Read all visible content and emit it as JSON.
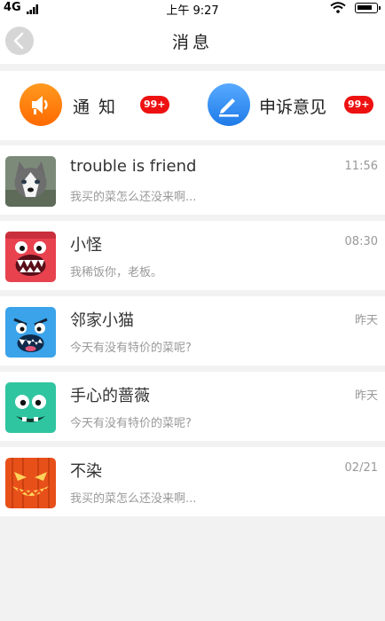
{
  "status_bar": {
    "carrier": "4G",
    "time": "上午 9:27",
    "signal_icon": "signal-icon",
    "wifi_icon": "wifi-icon",
    "battery_icon": "battery-icon"
  },
  "header": {
    "title": "消息",
    "back_icon": "chevron-left-icon"
  },
  "quick_actions": [
    {
      "label": "通知",
      "badge": "99+",
      "icon": "speaker-icon",
      "color": "#ff7a0a"
    },
    {
      "label": "申诉意见",
      "badge": "99+",
      "icon": "edit-icon",
      "color": "#2f8ef0"
    }
  ],
  "colors": {
    "badge": "#ee1111",
    "background": "#f2f2f2"
  },
  "messages": [
    {
      "name": "trouble is friend",
      "time": "11:56",
      "preview": "我买的菜怎么还没来啊...",
      "avatar": "husky-dog-avatar"
    },
    {
      "name": "小怪",
      "time": "08:30",
      "preview": "我稀饭你，老板。",
      "avatar": "red-monster-avatar"
    },
    {
      "name": "邻家小猫",
      "time": "昨天",
      "preview": "今天有没有特价的菜呢?",
      "avatar": "blue-monster-avatar"
    },
    {
      "name": "手心的蔷薇",
      "time": "昨天",
      "preview": "今天有没有特价的菜呢?",
      "avatar": "green-monster-avatar"
    },
    {
      "name": "不染",
      "time": "02/21",
      "preview": "我买的菜怎么还没来啊...",
      "avatar": "pumpkin-monster-avatar"
    }
  ]
}
